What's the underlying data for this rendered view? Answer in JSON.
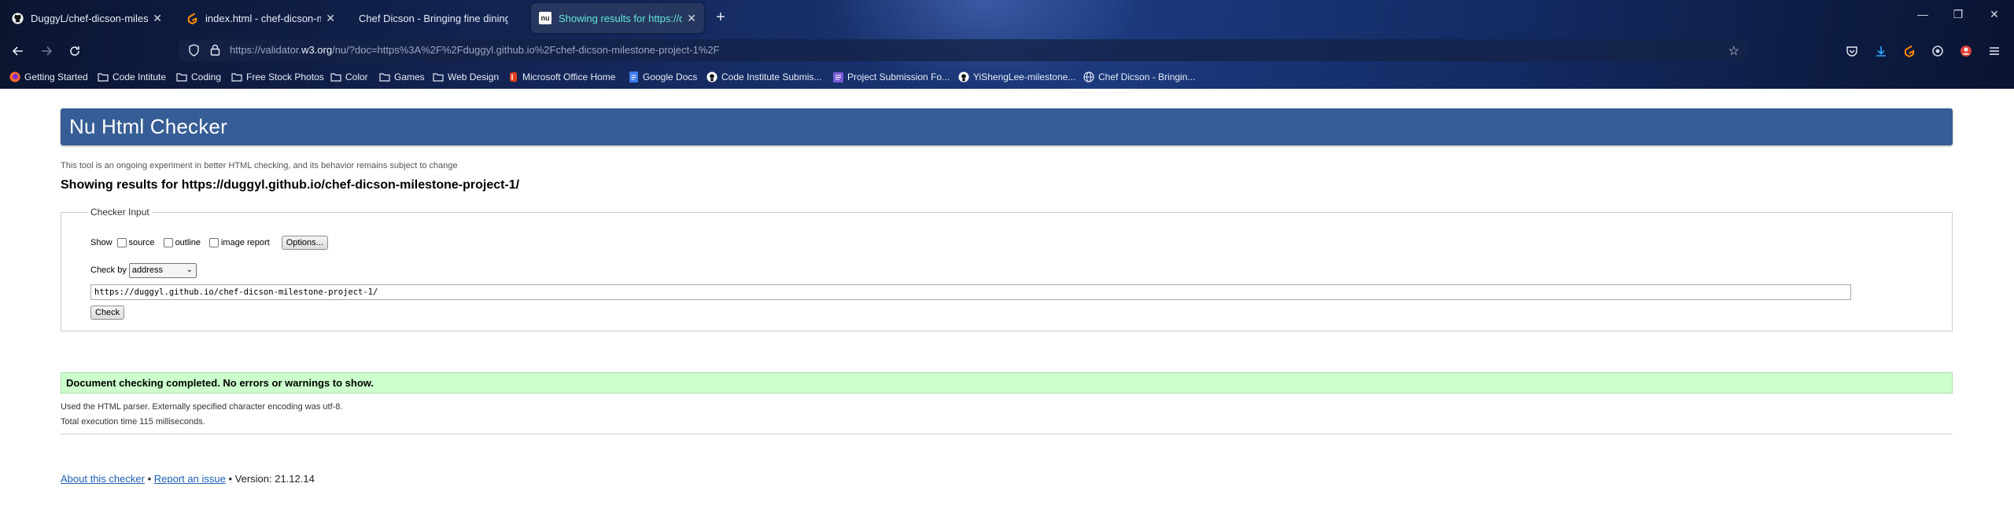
{
  "browser": {
    "tabs": [
      {
        "label": "DuggyL/chef-dicson-milestone",
        "icon": "github-icon",
        "active": false
      },
      {
        "label": "index.html - chef-dicson-milestone",
        "icon": "gitpod-icon",
        "active": false
      },
      {
        "label": "Chef Dicson - Bringing fine dining e",
        "icon": "",
        "active": false
      },
      {
        "label": "Showing results for https://dug",
        "icon": "nu-icon",
        "active": true
      }
    ],
    "nu_favicon_text": "nu",
    "url_prefix": "https://validator.",
    "url_domain": "w3.org",
    "url_rest": "/nu/?doc=https%3A%2F%2Fduggyl.github.io%2Fchef-dicson-milestone-project-1%2F",
    "bookmarks": [
      {
        "label": "Getting Started",
        "icon": "firefox-icon"
      },
      {
        "label": "Code Intitute",
        "icon": "folder-icon"
      },
      {
        "label": "Coding",
        "icon": "folder-icon"
      },
      {
        "label": "Free Stock Photos",
        "icon": "folder-icon"
      },
      {
        "label": "Color",
        "icon": "folder-icon"
      },
      {
        "label": "Games",
        "icon": "folder-icon"
      },
      {
        "label": "Web Design",
        "icon": "folder-icon"
      },
      {
        "label": "Microsoft Office Home",
        "icon": "office-icon"
      },
      {
        "label": "Google Docs",
        "icon": "docs-icon"
      },
      {
        "label": "Code Institute Submis...",
        "icon": "github-icon"
      },
      {
        "label": "Project Submission Fo...",
        "icon": "form-icon"
      },
      {
        "label": "YiShengLee-milestone...",
        "icon": "github-icon"
      },
      {
        "label": "Chef Dicson - Bringin...",
        "icon": "globe-icon"
      }
    ]
  },
  "page": {
    "title": "Nu Html Checker",
    "tagline": "This tool is an ongoing experiment in better HTML checking, and its behavior remains subject to change",
    "heading": "Showing results for https://duggyl.github.io/chef-dicson-milestone-project-1/",
    "checker_input": {
      "legend": "Checker Input",
      "show_label": "Show",
      "options": [
        "source",
        "outline",
        "image report"
      ],
      "options_button": "Options...",
      "check_by_label": "Check by",
      "check_by_value": "address",
      "url_value": "https://duggyl.github.io/chef-dicson-milestone-project-1/",
      "check_button": "Check"
    },
    "result": {
      "success": "Document checking completed. No errors or warnings to show.",
      "parser_info": "Used the HTML parser. Externally specified character encoding was utf-8.",
      "execution_time": "Total execution time 115 milliseconds."
    },
    "footer": {
      "about": "About this checker",
      "sep": "•",
      "report": "Report an issue",
      "version": "Version: 21.12.14"
    }
  },
  "colors": {
    "banner": "#365d95",
    "success_bg": "#ccffcc",
    "active_tab_text": "#5ee8d6",
    "link": "#1d5fb4"
  }
}
